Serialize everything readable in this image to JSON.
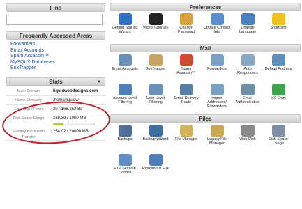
{
  "left": {
    "find_title": "Find",
    "faa_title": "Frequently Accessed Areas",
    "faa_links": [
      "Forwarders",
      "Email Accounts",
      "Spam Assassin™",
      "MySQL® Databases",
      "BoxTrapper"
    ],
    "stats_title": "Stats",
    "stats": [
      {
        "label": "Main Domain",
        "value": "liquidwebdesigns.com"
      },
      {
        "label": "Home Directory",
        "value": "/home/liquidw"
      },
      {
        "label": "Last Login From",
        "value": "207.168.253.80"
      },
      {
        "label": "Disk Space Usage",
        "value": "238.39 / 1000 MB"
      },
      {
        "label": "Monthly Bandwidth Transfer",
        "value": "254.02 / 20000 MB"
      }
    ],
    "disk_usage_fraction": 0.238
  },
  "sections": {
    "preferences": {
      "title": "Preferences",
      "items": [
        {
          "label": "Getting Started Wizard",
          "icon": "wizard-icon",
          "color": "#2f6fc4"
        },
        {
          "label": "Video Tutorials",
          "icon": "video-icon",
          "color": "#222222"
        },
        {
          "label": "Change Password",
          "icon": "password-icon",
          "color": "#d8a040"
        },
        {
          "label": "Update Contact Info",
          "icon": "contact-icon",
          "color": "#5a8fcf"
        },
        {
          "label": "Change Language",
          "icon": "language-icon",
          "color": "#4a7fc1"
        },
        {
          "label": "Shortcuts",
          "icon": "star-icon",
          "color": "#f2c023"
        }
      ]
    },
    "mail": {
      "title": "Mail",
      "items": [
        {
          "label": "Email Accounts",
          "icon": "email-icon",
          "color": "#6a8fb8"
        },
        {
          "label": "BoxTrapper",
          "icon": "boxtrapper-icon",
          "color": "#c8a368"
        },
        {
          "label": "Spam Assassin™",
          "icon": "spam-icon",
          "color": "#d04a2f"
        },
        {
          "label": "Forwarders",
          "icon": "forwarders-icon",
          "color": "#7a9fc4"
        },
        {
          "label": "Auto Responders",
          "icon": "autoresponder-icon",
          "color": "#8aa7c6"
        },
        {
          "label": "Default Address",
          "icon": "default-address-icon",
          "color": "#5f8fbd"
        },
        {
          "label": "Account Level Filtering",
          "icon": "filter-icon",
          "color": "#4f7fb4"
        },
        {
          "label": "User Level Filtering",
          "icon": "user-filter-icon",
          "color": "#6a8fb8"
        },
        {
          "label": "Email Delivery Route",
          "icon": "delivery-icon",
          "color": "#5a7fa6"
        },
        {
          "label": "Import Addresses/ Forwarders",
          "icon": "import-icon",
          "color": "#7d9fc2"
        },
        {
          "label": "Email Authentication",
          "icon": "authentication-icon",
          "color": "#6f8ea8"
        },
        {
          "label": "MX Entry",
          "icon": "mx-icon",
          "color": "#3fa34d"
        }
      ]
    },
    "files": {
      "title": "Files",
      "items": [
        {
          "label": "Backups",
          "icon": "backups-icon",
          "color": "#4f6f9a"
        },
        {
          "label": "Backup Wizard",
          "icon": "backup-wizard-icon",
          "color": "#3f6f9f"
        },
        {
          "label": "File Manager",
          "icon": "file-manager-icon",
          "color": "#d2b35a"
        },
        {
          "label": "Legacy File Manager",
          "icon": "legacy-file-manager-icon",
          "color": "#c9a954"
        },
        {
          "label": "Web Disk",
          "icon": "web-disk-icon",
          "color": "#8a8a8a"
        },
        {
          "label": "Disk Space Usage",
          "icon": "disk-usage-icon",
          "color": "#7f8fa4"
        },
        {
          "label": "FTP Session Control",
          "icon": "ftp-session-icon",
          "color": "#5f8fc4"
        },
        {
          "label": "Anonymous FTP",
          "icon": "anonymous-ftp-icon",
          "color": "#4f7fb8"
        }
      ]
    }
  }
}
